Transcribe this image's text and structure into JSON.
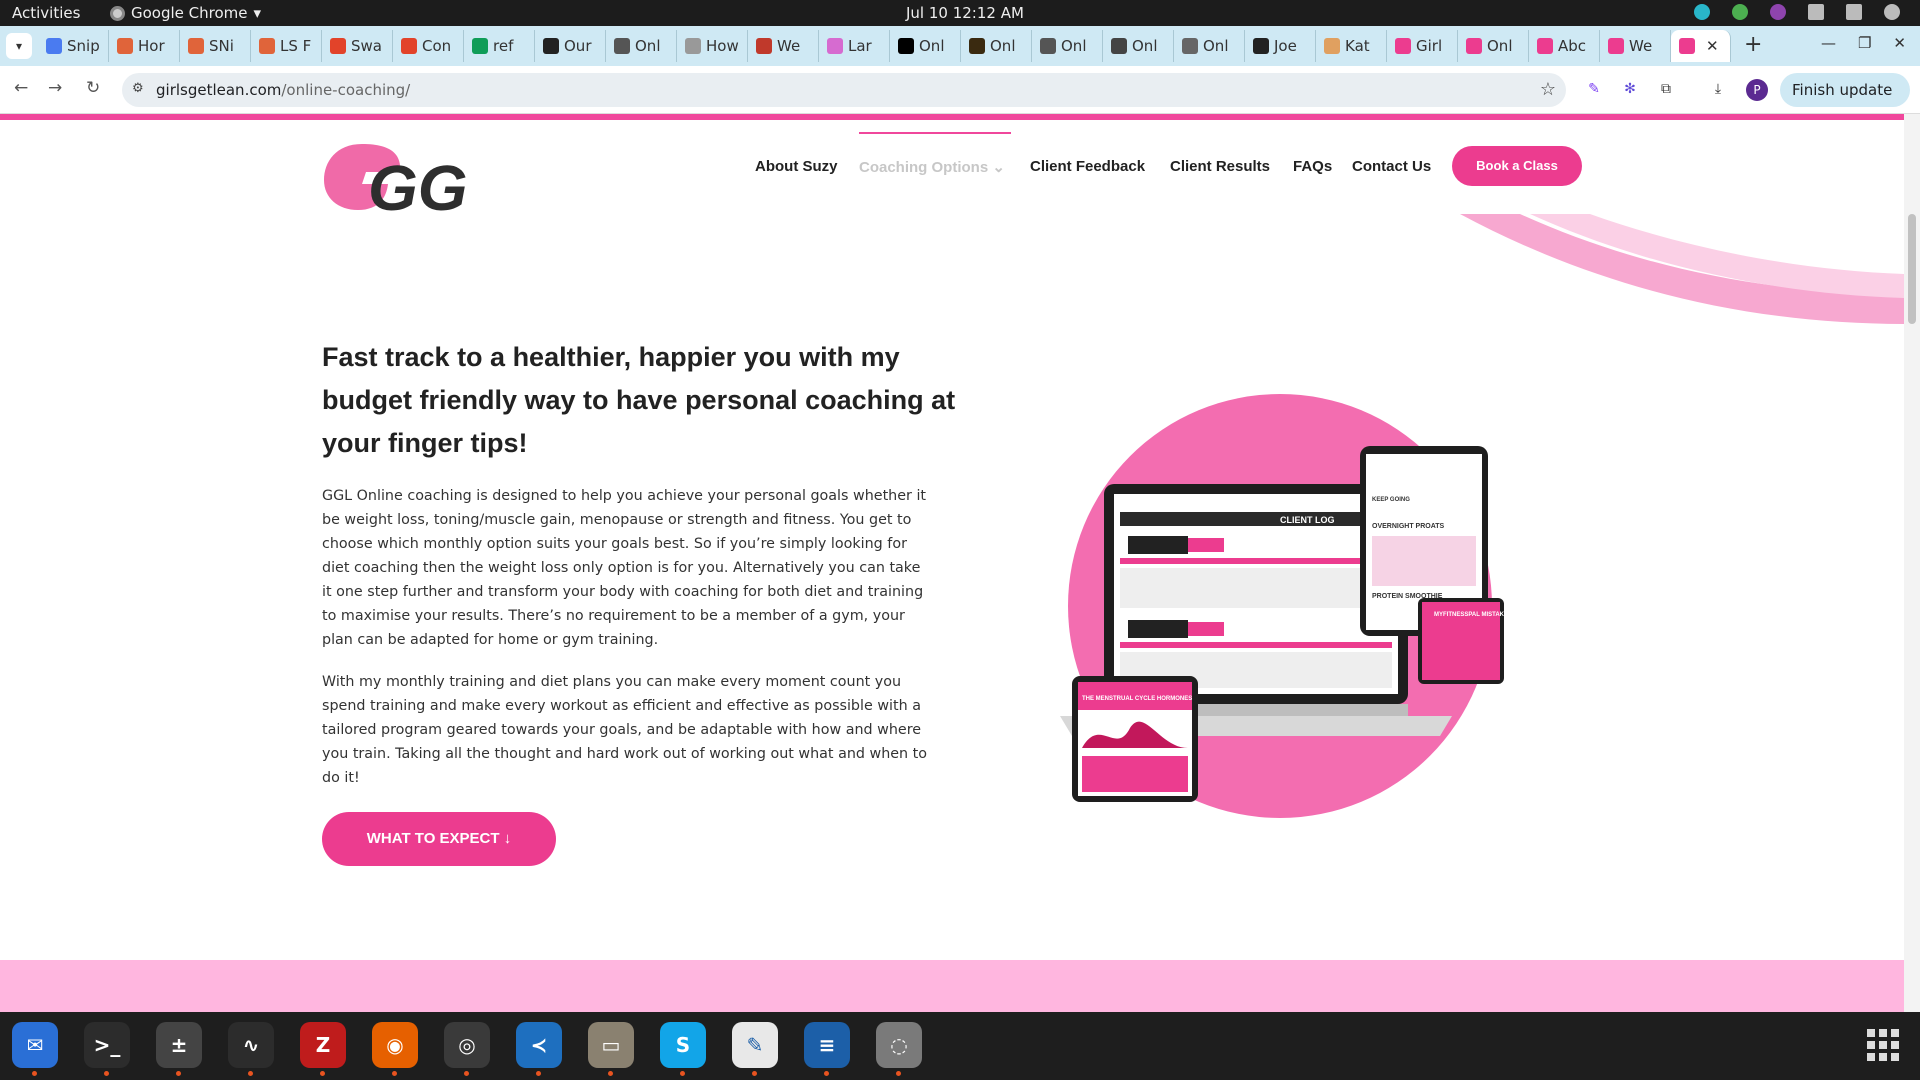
{
  "system": {
    "activities": "Activities",
    "app_name": "Google Chrome",
    "clock": "Jul 10  12:12 AM"
  },
  "tabs": [
    {
      "label": "Snip",
      "color": "#4a7bf0"
    },
    {
      "label": "Hor",
      "color": "#e0643a"
    },
    {
      "label": "SNi",
      "color": "#e0643a"
    },
    {
      "label": "LS F",
      "color": "#e0643a"
    },
    {
      "label": "Swa",
      "color": "#e2432a"
    },
    {
      "label": "Con",
      "color": "#e2432a"
    },
    {
      "label": "ref",
      "color": "#0f9d58"
    },
    {
      "label": "Our",
      "color": "#222222"
    },
    {
      "label": "Onl",
      "color": "#555555"
    },
    {
      "label": "How",
      "color": "#999999"
    },
    {
      "label": "We",
      "color": "#c0392b"
    },
    {
      "label": "Lar",
      "color": "#d66bd0"
    },
    {
      "label": "Onl",
      "color": "#000000"
    },
    {
      "label": "Onl",
      "color": "#3a2a10"
    },
    {
      "label": "Onl",
      "color": "#555555"
    },
    {
      "label": "Onl",
      "color": "#444444"
    },
    {
      "label": "Onl",
      "color": "#666666"
    },
    {
      "label": "Joe",
      "color": "#222222"
    },
    {
      "label": "Kat",
      "color": "#e0a060"
    },
    {
      "label": "Girl",
      "color": "#ec3c8f"
    },
    {
      "label": "Onl",
      "color": "#ec3c8f"
    },
    {
      "label": "Abc",
      "color": "#ec3c8f"
    },
    {
      "label": "We",
      "color": "#ec3c8f"
    }
  ],
  "toolbar": {
    "url_domain": "girlsgetlean.com",
    "url_path": "/online-coaching/",
    "profile_initial": "P",
    "finish_update": "Finish update"
  },
  "site": {
    "logo_text": "GGL",
    "nav": {
      "about": "About Suzy",
      "coaching": "Coaching Options",
      "feedback": "Client Feedback",
      "results": "Client Results",
      "faqs": "FAQs",
      "contact": "Contact Us",
      "book": "Book a Class"
    },
    "headline": "Fast track to a healthier, happier you with my budget friendly way to have personal coaching at your finger tips!",
    "paragraph1": "GGL Online coaching is designed to help you achieve your personal goals whether it be weight loss, toning/muscle gain, menopause or strength and fitness. You get to choose which monthly option suits your goals best. So if you’re simply looking for diet coaching then the weight loss only option is for you. Alternatively you can take it one step further and transform your body with coaching for both diet and training to maximise your results. There’s no requirement to be a member of a gym, your plan can be adapted for home or gym training.",
    "paragraph2": "With my monthly training and diet plans you can make every moment count you spend training and make every workout as efficient and effective as possible with a tailored program geared towards your goals, and be adaptable with how and where you train. Taking all the thought and hard work out of working out what and when to do it!",
    "cta": "WHAT TO EXPECT",
    "mockup": {
      "client_log": "CLIENT LOG",
      "keep_going": "KEEP GOING",
      "overnight_oats": "OVERNIGHT PROATS",
      "protein_smoothie": "PROTEIN SMOOTHIE",
      "menstrual_title": "THE MENSTRUAL CYCLE HORMONES",
      "mfp_title": "MYFITNESSPAL MISTAKES"
    }
  },
  "colors": {
    "brand_pink": "#ec3c8f",
    "light_pink": "#ffb6df",
    "chrome_blue": "#cfe9f4"
  },
  "dock": [
    {
      "name": "thunderbird",
      "glyph": "✉",
      "bg": "#2a6fd6"
    },
    {
      "name": "terminal",
      "glyph": ">_",
      "bg": "#2c2c2c"
    },
    {
      "name": "calculator",
      "glyph": "±",
      "bg": "#444444"
    },
    {
      "name": "system-monitor",
      "glyph": "∿",
      "bg": "#2c2c2c"
    },
    {
      "name": "filezilla",
      "glyph": "Z",
      "bg": "#bf1c1c"
    },
    {
      "name": "firefox",
      "glyph": "◉",
      "bg": "#e66000"
    },
    {
      "name": "chrome",
      "glyph": "◎",
      "bg": "#3a3a3a"
    },
    {
      "name": "vscode",
      "glyph": "≺",
      "bg": "#1e6fbf"
    },
    {
      "name": "files",
      "glyph": "▭",
      "bg": "#8a8170"
    },
    {
      "name": "skype",
      "glyph": "S",
      "bg": "#12a5e8"
    },
    {
      "name": "text-editor",
      "glyph": "✎",
      "bg": "#e8e8e8"
    },
    {
      "name": "libreoffice-writer",
      "glyph": "≡",
      "bg": "#1c5fa8"
    },
    {
      "name": "disks",
      "glyph": "◌",
      "bg": "#7a7a7a"
    }
  ]
}
